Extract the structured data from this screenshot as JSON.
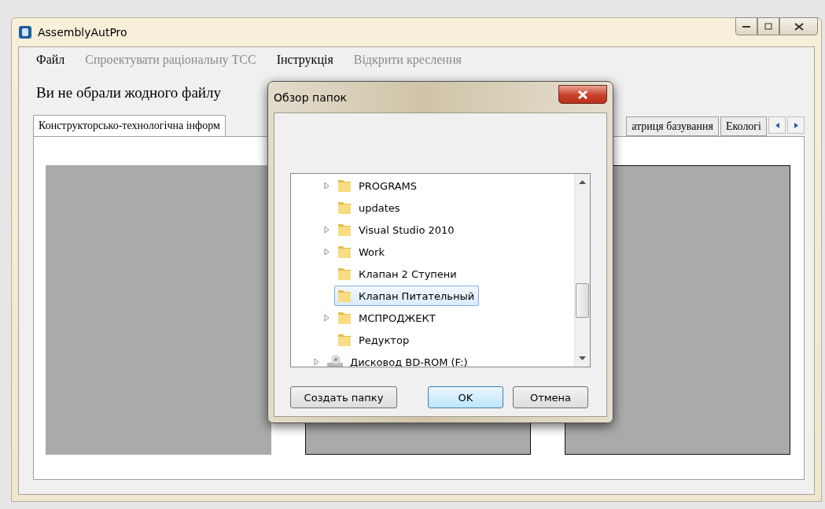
{
  "window": {
    "title": "AssemblyAutPro"
  },
  "menu": [
    {
      "label": "Файл",
      "disabled": false
    },
    {
      "label": "Спроектувати раціональну ТСС",
      "disabled": true
    },
    {
      "label": "Інструкція",
      "disabled": false
    },
    {
      "label": "Відкрити креслення",
      "disabled": true
    }
  ],
  "status_label": "Ви не обрали жодного файлу",
  "tabs": [
    {
      "label": "Конструкторсько-технологічна інформ",
      "selected": true
    },
    {
      "label": "атриця базування",
      "selected": false
    },
    {
      "label": "Екологі",
      "selected": false
    }
  ],
  "panels": [
    {
      "bordered": false
    },
    {
      "bordered": true
    },
    {
      "bordered": true
    }
  ],
  "dialog": {
    "title": "Обзор папок",
    "tree": [
      {
        "label": "PROGRAMS",
        "kind": "folder",
        "expandable": true,
        "selected": false
      },
      {
        "label": "updates",
        "kind": "folder",
        "expandable": false,
        "selected": false
      },
      {
        "label": "Visual Studio 2010",
        "kind": "folder",
        "expandable": true,
        "selected": false
      },
      {
        "label": "Work",
        "kind": "folder",
        "expandable": true,
        "selected": false
      },
      {
        "label": "Клапан 2 Ступени",
        "kind": "folder",
        "expandable": false,
        "selected": false
      },
      {
        "label": "Клапан Питательный",
        "kind": "folder",
        "expandable": false,
        "selected": true
      },
      {
        "label": "МСПРОДЖЕКТ",
        "kind": "folder",
        "expandable": true,
        "selected": false
      },
      {
        "label": "Редуктор",
        "kind": "folder",
        "expandable": false,
        "selected": false
      },
      {
        "label": "Дисковод BD-ROM (F:)",
        "kind": "drive",
        "expandable": true,
        "selected": false
      }
    ],
    "buttons": [
      {
        "label": "Создать папку",
        "default": false
      },
      {
        "label": "OK",
        "default": true
      },
      {
        "label": "Отмена",
        "default": false
      }
    ]
  }
}
